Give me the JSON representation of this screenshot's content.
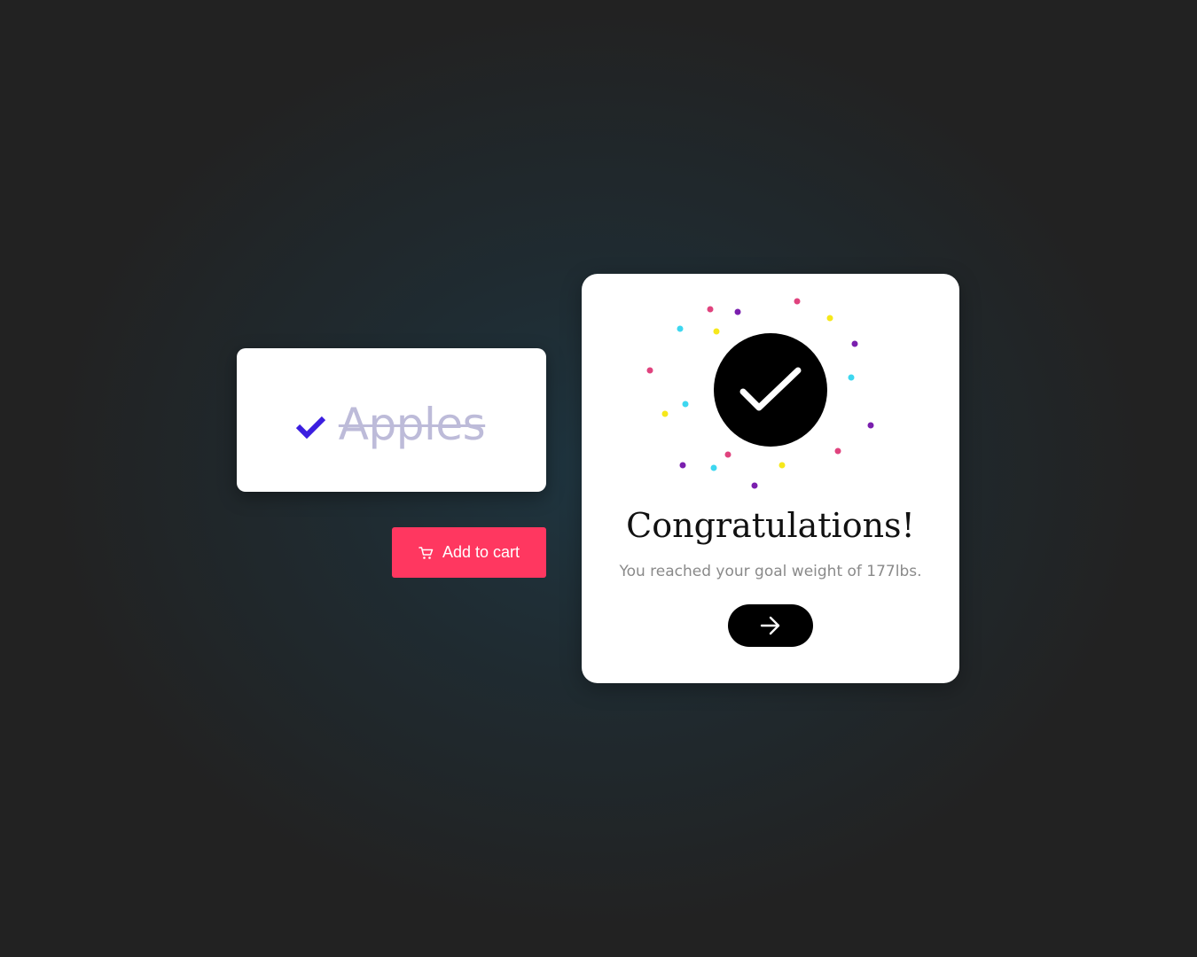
{
  "todo": {
    "label": "Apples",
    "completed": true,
    "check_color": "#3b1ee0",
    "label_color": "#bdbbd9"
  },
  "cart_button": {
    "label": "Add to cart",
    "icon": "cart-icon",
    "color": "#ff3760"
  },
  "congrats": {
    "icon": "checkmark-icon",
    "title": "Congratulations!",
    "message": "You reached your goal weight of 177lbs.",
    "next_icon": "arrow-right-icon",
    "confetti_colors": [
      "#e0437e",
      "#7a1fae",
      "#f6e81b",
      "#3dd7f0"
    ]
  }
}
